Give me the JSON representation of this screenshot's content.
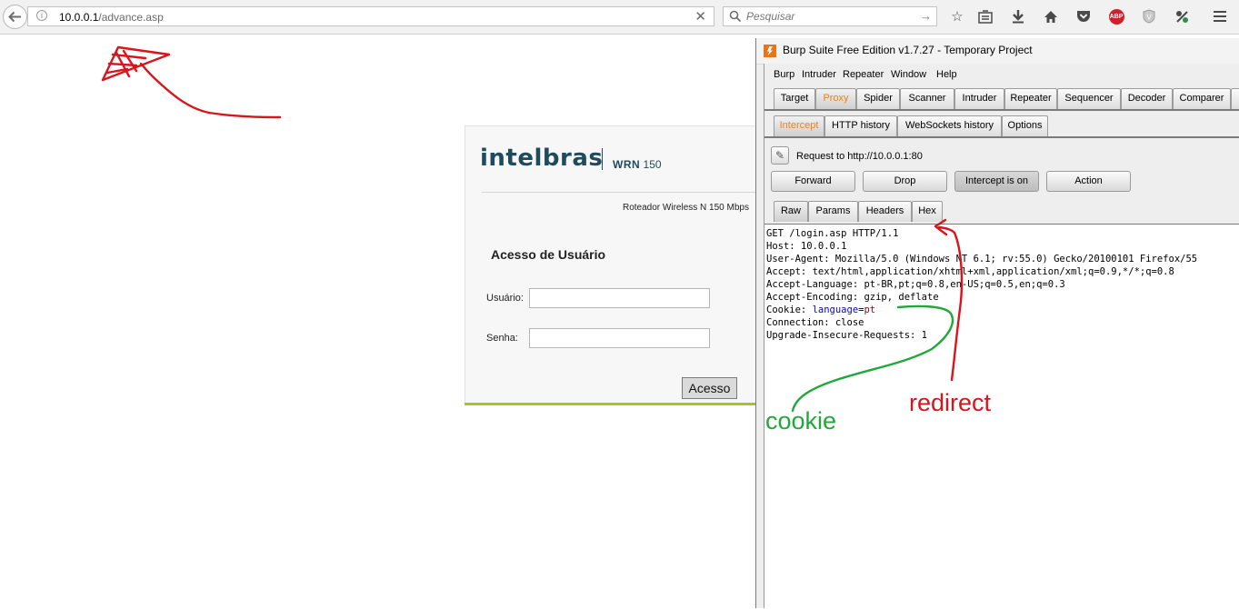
{
  "browser": {
    "url_host": "10.0.0.1",
    "url_path": "/advance.asp",
    "search_placeholder": "Pesquisar",
    "abp_label": "ABP"
  },
  "router": {
    "brand": "intelbras",
    "model_prefix": "WRN",
    "model_number": "150",
    "description": "Roteador Wireless N 150 Mbps",
    "form_title": "Acesso de Usuário",
    "username_label": "Usuário:",
    "password_label": "Senha:",
    "submit_label": "Acesso"
  },
  "burp": {
    "title": "Burp Suite Free Edition v1.7.27 - Temporary Project",
    "menu": [
      "Burp",
      "Intruder",
      "Repeater",
      "Window",
      "Help"
    ],
    "main_tabs": [
      "Target",
      "Proxy",
      "Spider",
      "Scanner",
      "Intruder",
      "Repeater",
      "Sequencer",
      "Decoder",
      "Comparer"
    ],
    "active_main_tab": "Proxy",
    "proxy_tabs": [
      "Intercept",
      "HTTP history",
      "WebSockets history",
      "Options"
    ],
    "active_proxy_tab": "Intercept",
    "request_to": "Request to http://10.0.0.1:80",
    "buttons": [
      "Forward",
      "Drop",
      "Intercept is on",
      "Action"
    ],
    "view_tabs": [
      "Raw",
      "Params",
      "Headers",
      "Hex"
    ],
    "active_view_tab": "Raw",
    "request_lines": [
      "GET /login.asp HTTP/1.1",
      "Host: 10.0.0.1",
      "User-Agent: Mozilla/5.0 (Windows NT 6.1; rv:55.0) Gecko/20100101 Firefox/55",
      "Accept: text/html,application/xhtml+xml,application/xml;q=0.9,*/*;q=0.8",
      "Accept-Language: pt-BR,pt;q=0.8,en-US;q=0.5,en;q=0.3",
      "Accept-Encoding: gzip, deflate",
      "Cookie: ",
      "Connection: close",
      "Upgrade-Insecure-Requests: 1"
    ],
    "cookie_name": "language",
    "cookie_eq": "=",
    "cookie_value": "pt"
  },
  "annotations": {
    "cookie_label": "cookie",
    "redirect_label": "redirect",
    "cookie_color": "#22a83a",
    "redirect_color": "#d8141c",
    "arrow_color": "#d8141c"
  }
}
